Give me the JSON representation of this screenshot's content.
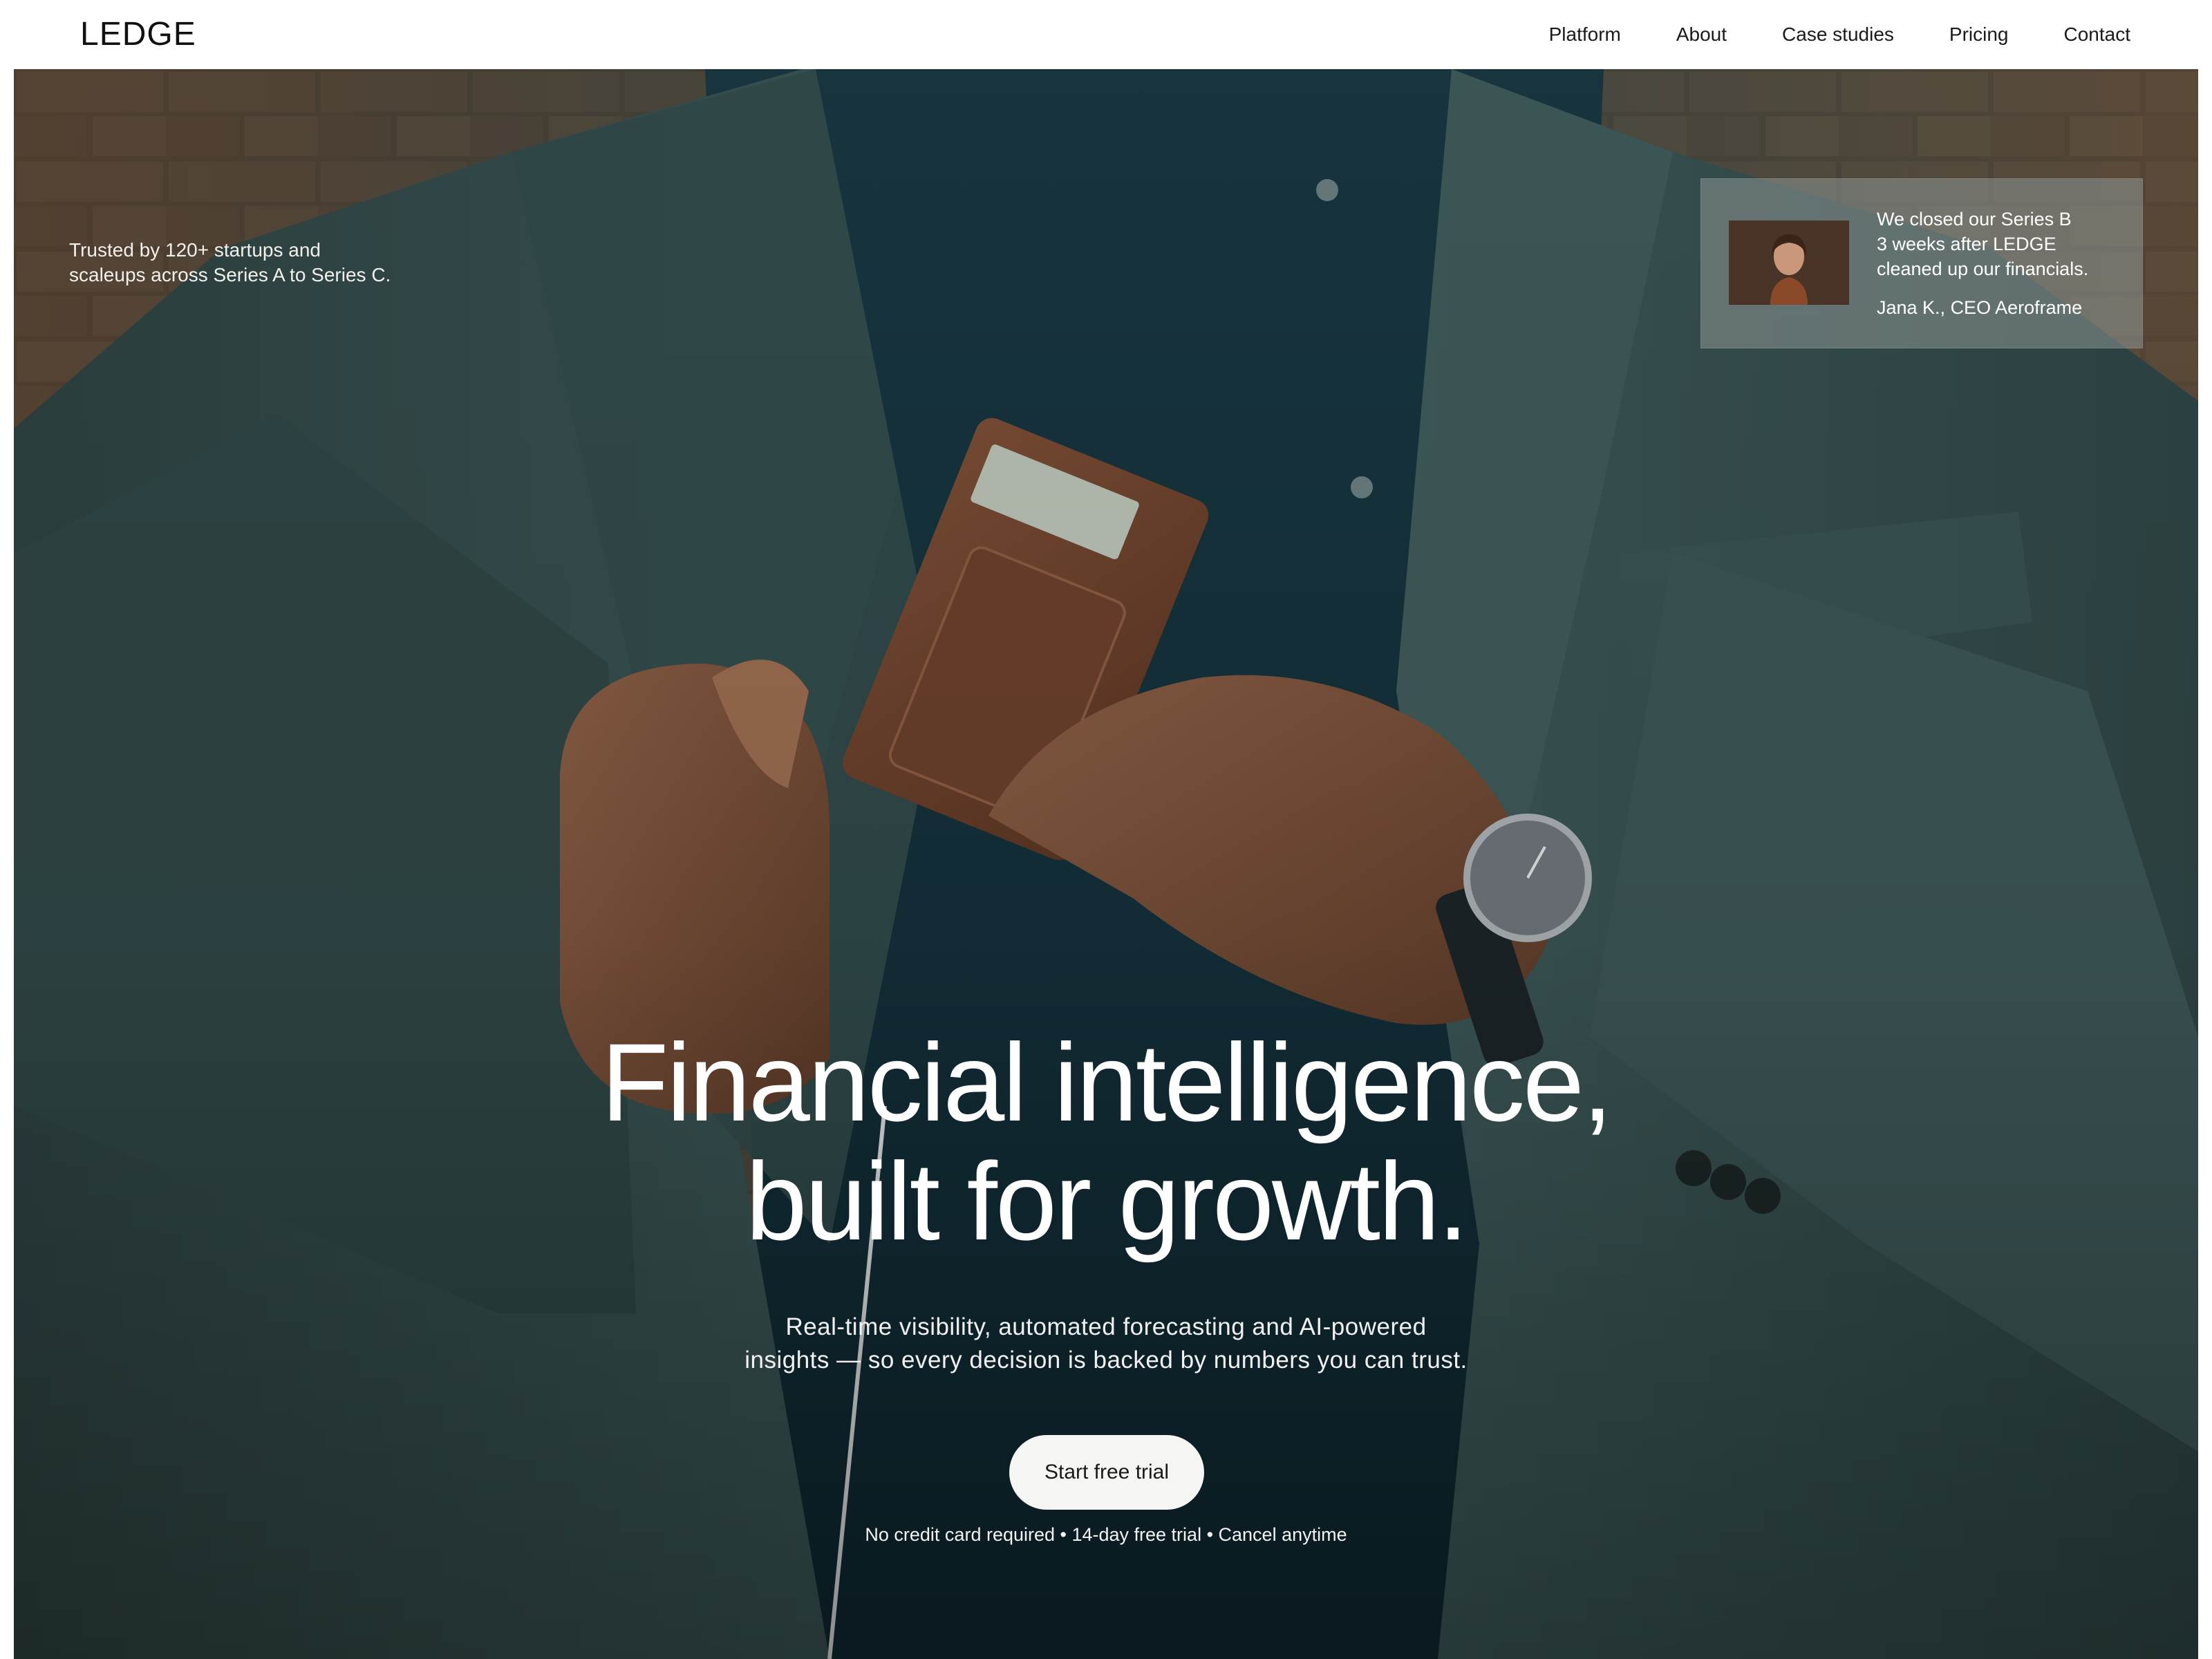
{
  "brand": {
    "name": "LEDGE"
  },
  "nav": {
    "items": [
      {
        "label": "Platform"
      },
      {
        "label": "About"
      },
      {
        "label": "Case studies"
      },
      {
        "label": "Pricing"
      },
      {
        "label": "Contact"
      }
    ]
  },
  "hero": {
    "trusted_line1": "Trusted by 120+ startups and",
    "trusted_line2": "scaleups across Series A to Series C.",
    "headline_line1": "Financial intelligence,",
    "headline_line2": "built for growth.",
    "subcopy_line1": "Real-time visibility, automated forecasting and AI-powered",
    "subcopy_line2": "insights — so every decision is backed by numbers you can trust.",
    "cta_label": "Start free trial",
    "fineprint": "No credit card required • 14-day free trial • Cancel anytime",
    "image": "man-in-suit-placing-wallet-in-jacket-photo"
  },
  "testimonial": {
    "quote_line1": "We closed our Series B",
    "quote_line2": "3 weeks after LEDGE",
    "quote_line3": "cleaned up our financials.",
    "author": "Jana K., CEO Aeroframe",
    "photo": "woman-portrait-photo"
  },
  "colors": {
    "header_bg": "#ffffff",
    "hero_text": "#ffffff",
    "cta_bg": "#f5f5f4",
    "jacket": "#34504f",
    "shirt": "#14303a",
    "wall": "#5a4636"
  }
}
